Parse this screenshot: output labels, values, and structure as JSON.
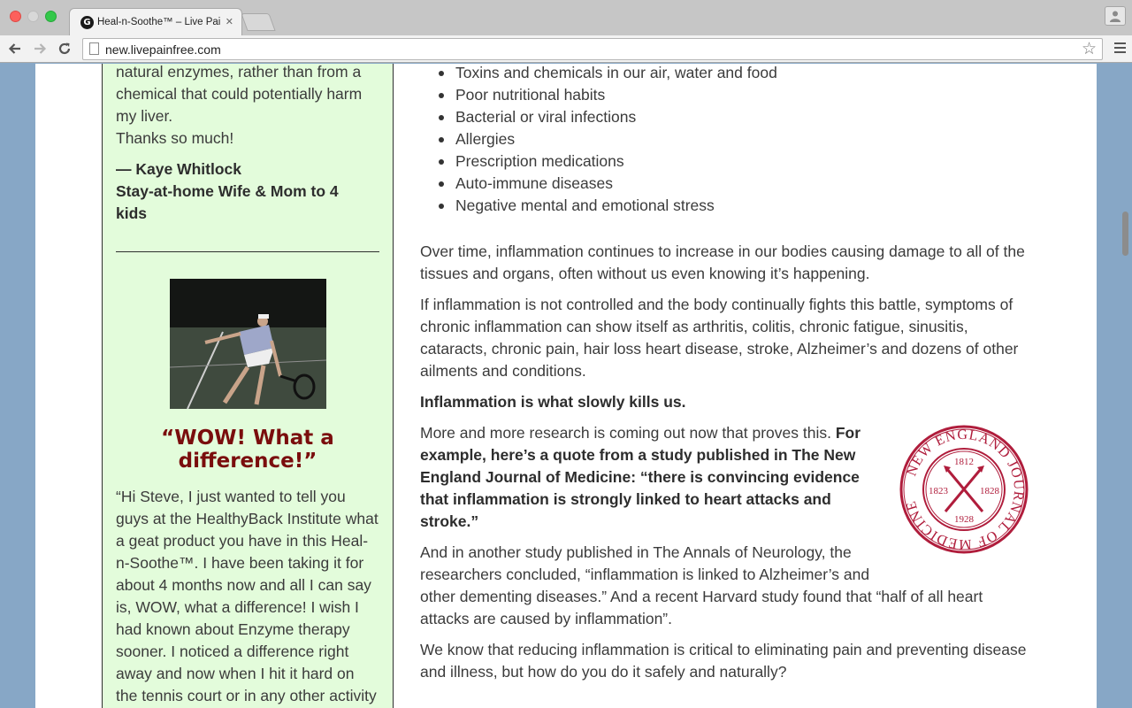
{
  "browser": {
    "tab_title": "Heal-n-Soothe™ – Live Pai",
    "tab_favicon_letter": "G",
    "url": "new.livepainfree.com"
  },
  "sidebar": {
    "testimonial1_lines": [
      "natural enzymes, rather than from a",
      "chemical that could potentially harm",
      "my liver.",
      "Thanks so much!"
    ],
    "attribution_name": "— Kaye Whitlock",
    "attribution_role_lines": [
      "Stay-at-home Wife & Mom to 4",
      "kids"
    ],
    "headline_lines": [
      "“WOW! What a",
      "difference!”"
    ],
    "testimonial2_lines": [
      "“Hi Steve, I just wanted to tell you",
      "guys at the HealthyBack Institute what",
      "a geat product you have in this Heal-",
      "n-Soothe™. I have been taking it for",
      "about 4 months now and all I can say",
      "is, WOW, what a difference! I wish I",
      "had known about Enzyme therapy",
      "sooner. I noticed a difference right",
      "away and now when I hit it hard on",
      "the tennis court or in any other activity"
    ]
  },
  "main": {
    "bullets": [
      "Toxins and chemicals in our air, water and food",
      "Poor nutritional habits",
      "Bacterial or viral infections",
      "Allergies",
      "Prescription medications",
      "Auto-immune diseases",
      "Negative mental and emotional stress"
    ],
    "p1_lines": [
      "Over time, inflammation continues to increase in our bodies causing damage to all of the",
      "tissues and organs, often without us even knowing it’s happening."
    ],
    "p2_lines": [
      "If inflammation is not controlled and the body continually fights this battle, symptoms of",
      "chronic inflammation can show itself as arthritis, colitis, chronic fatigue, sinusitis,",
      "cataracts, chronic pain, hair loss heart disease, stroke, Alzheimer’s and dozens of other",
      "ailments and conditions."
    ],
    "p3_bold": "Inflammation is what slowly kills us.",
    "p4_line1_plain": "More and more research is coming out now that proves this. ",
    "p4_line1_bold": "For",
    "p4_bold_lines": [
      "example, here’s a quote from a study published in The New",
      "England Journal of Medicine: “there is convincing evidence",
      "that inflammation is strongly linked to heart attacks and",
      "stroke.”"
    ],
    "p5_lines": [
      "And in another study published in The Annals of Neurology, the",
      "researchers concluded, “inflammation is linked to Alzheimer’s and",
      "other dementing diseases.” And a recent Harvard study found that “half of all heart",
      "attacks are caused by inflammation”."
    ],
    "p6_lines": [
      "We know that reducing inflammation is critical to eliminating pain and preventing disease",
      "and illness, but how do you do it safely and naturally?"
    ],
    "seal": {
      "ring_text": "NEW ENGLAND JOURNAL OF MEDICINE",
      "year_top": "1812",
      "year_left": "1823",
      "year_right": "1828",
      "year_bottom": "1928",
      "color": "#b01d3c"
    }
  }
}
